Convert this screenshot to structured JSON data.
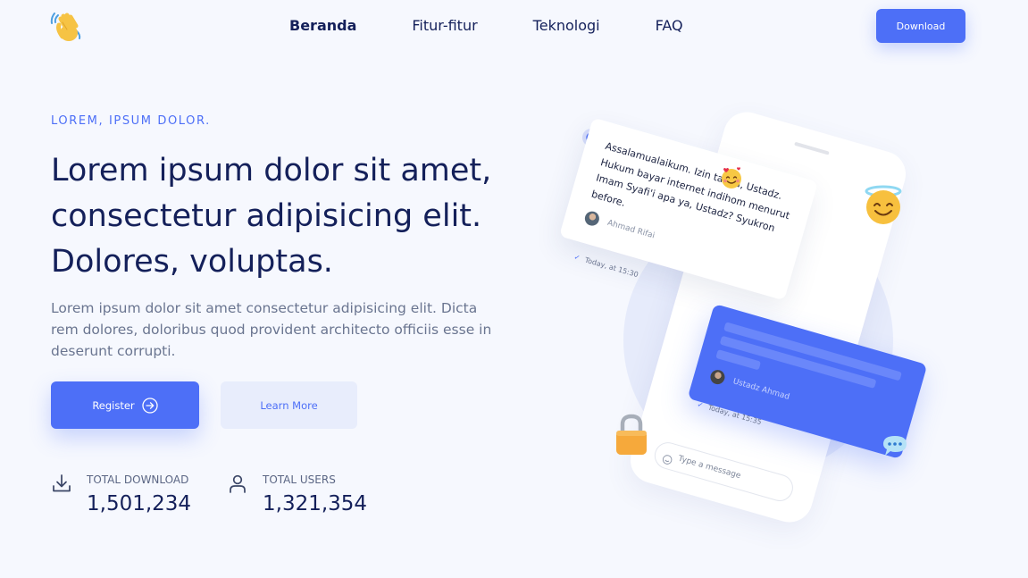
{
  "nav": {
    "logo_icon": "waving-hand-icon",
    "items": [
      "Beranda",
      "Fitur-fitur",
      "Teknologi",
      "FAQ"
    ],
    "download_label": "Download"
  },
  "hero": {
    "eyebrow": "LOREM, IPSUM DOLOR.",
    "headline": "Lorem ipsum dolor sit amet, consectetur adipisicing elit. Dolores, voluptas.",
    "lead": "Lorem ipsum dolor sit amet consectetur adipisicing elit. Dicta rem dolores, doloribus quod provident architecto officiis esse in deserunt corrupti.",
    "register_label": "Register",
    "learn_more_label": "Learn More"
  },
  "stats": [
    {
      "label": "TOTAL DOWNLOAD",
      "value": "1,501,234",
      "icon": "download-icon"
    },
    {
      "label": "TOTAL USERS",
      "value": "1,321,354",
      "icon": "user-icon"
    }
  ],
  "illustration": {
    "message_in": "Assalamualaikum. Izin tanya, Ustadz. Hukum bayar internet indihom menurut Imam Syafi'i apa ya, Ustadz? Syukron before.",
    "sender_in": "Ahmad Rifai",
    "time_in": "Today, at 15:30",
    "sender_out": "Ustadz Ahmad",
    "time_out": "Today, at 15:35",
    "input_placeholder": "Type a message"
  },
  "colors": {
    "accent": "#4d6ff7",
    "text_dark": "#14205a",
    "text_muted": "#6a7590",
    "background": "#f6f8fe"
  }
}
